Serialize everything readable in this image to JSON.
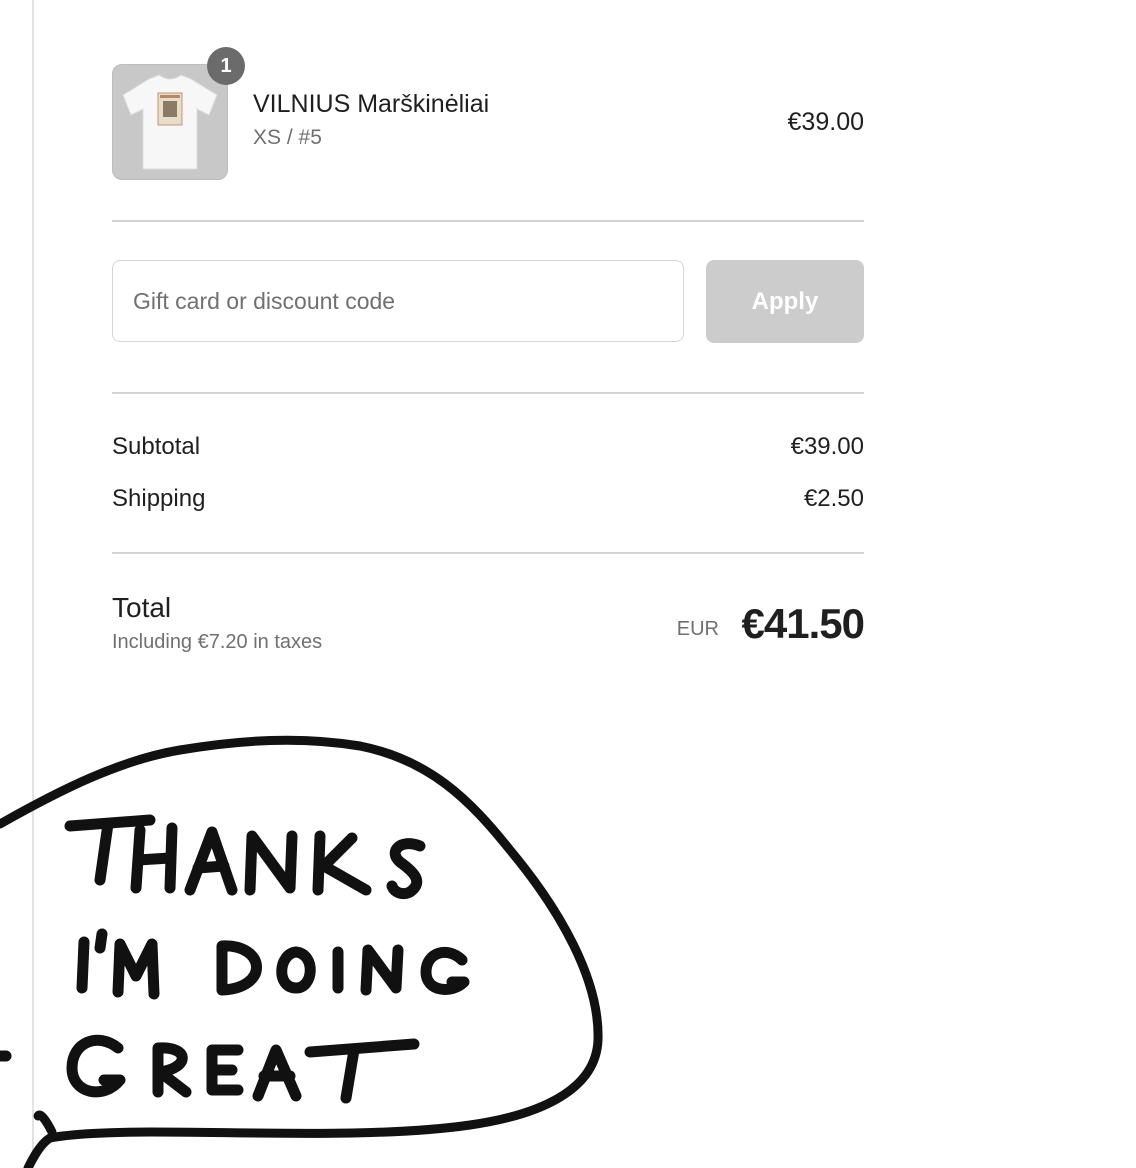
{
  "cart": {
    "item": {
      "quantity": "1",
      "name": "VILNIUS Marškinėliai",
      "variant": "XS / #5",
      "price": "€39.00"
    }
  },
  "discount": {
    "placeholder": "Gift card or discount code",
    "value": "",
    "apply_label": "Apply"
  },
  "costs": {
    "subtotal_label": "Subtotal",
    "subtotal_value": "€39.00",
    "shipping_label": "Shipping",
    "shipping_value": "€2.50"
  },
  "total": {
    "label": "Total",
    "tax_note": "Including €7.20 in taxes",
    "currency": "EUR",
    "value": "€41.50"
  },
  "illustration": {
    "text_lines": [
      "THANKS",
      "I'M DOING",
      "GREAT"
    ]
  },
  "colors": {
    "apply_button_disabled": "#cccccc",
    "badge": "#6b6b6b",
    "divider": "#d2d2d2"
  }
}
